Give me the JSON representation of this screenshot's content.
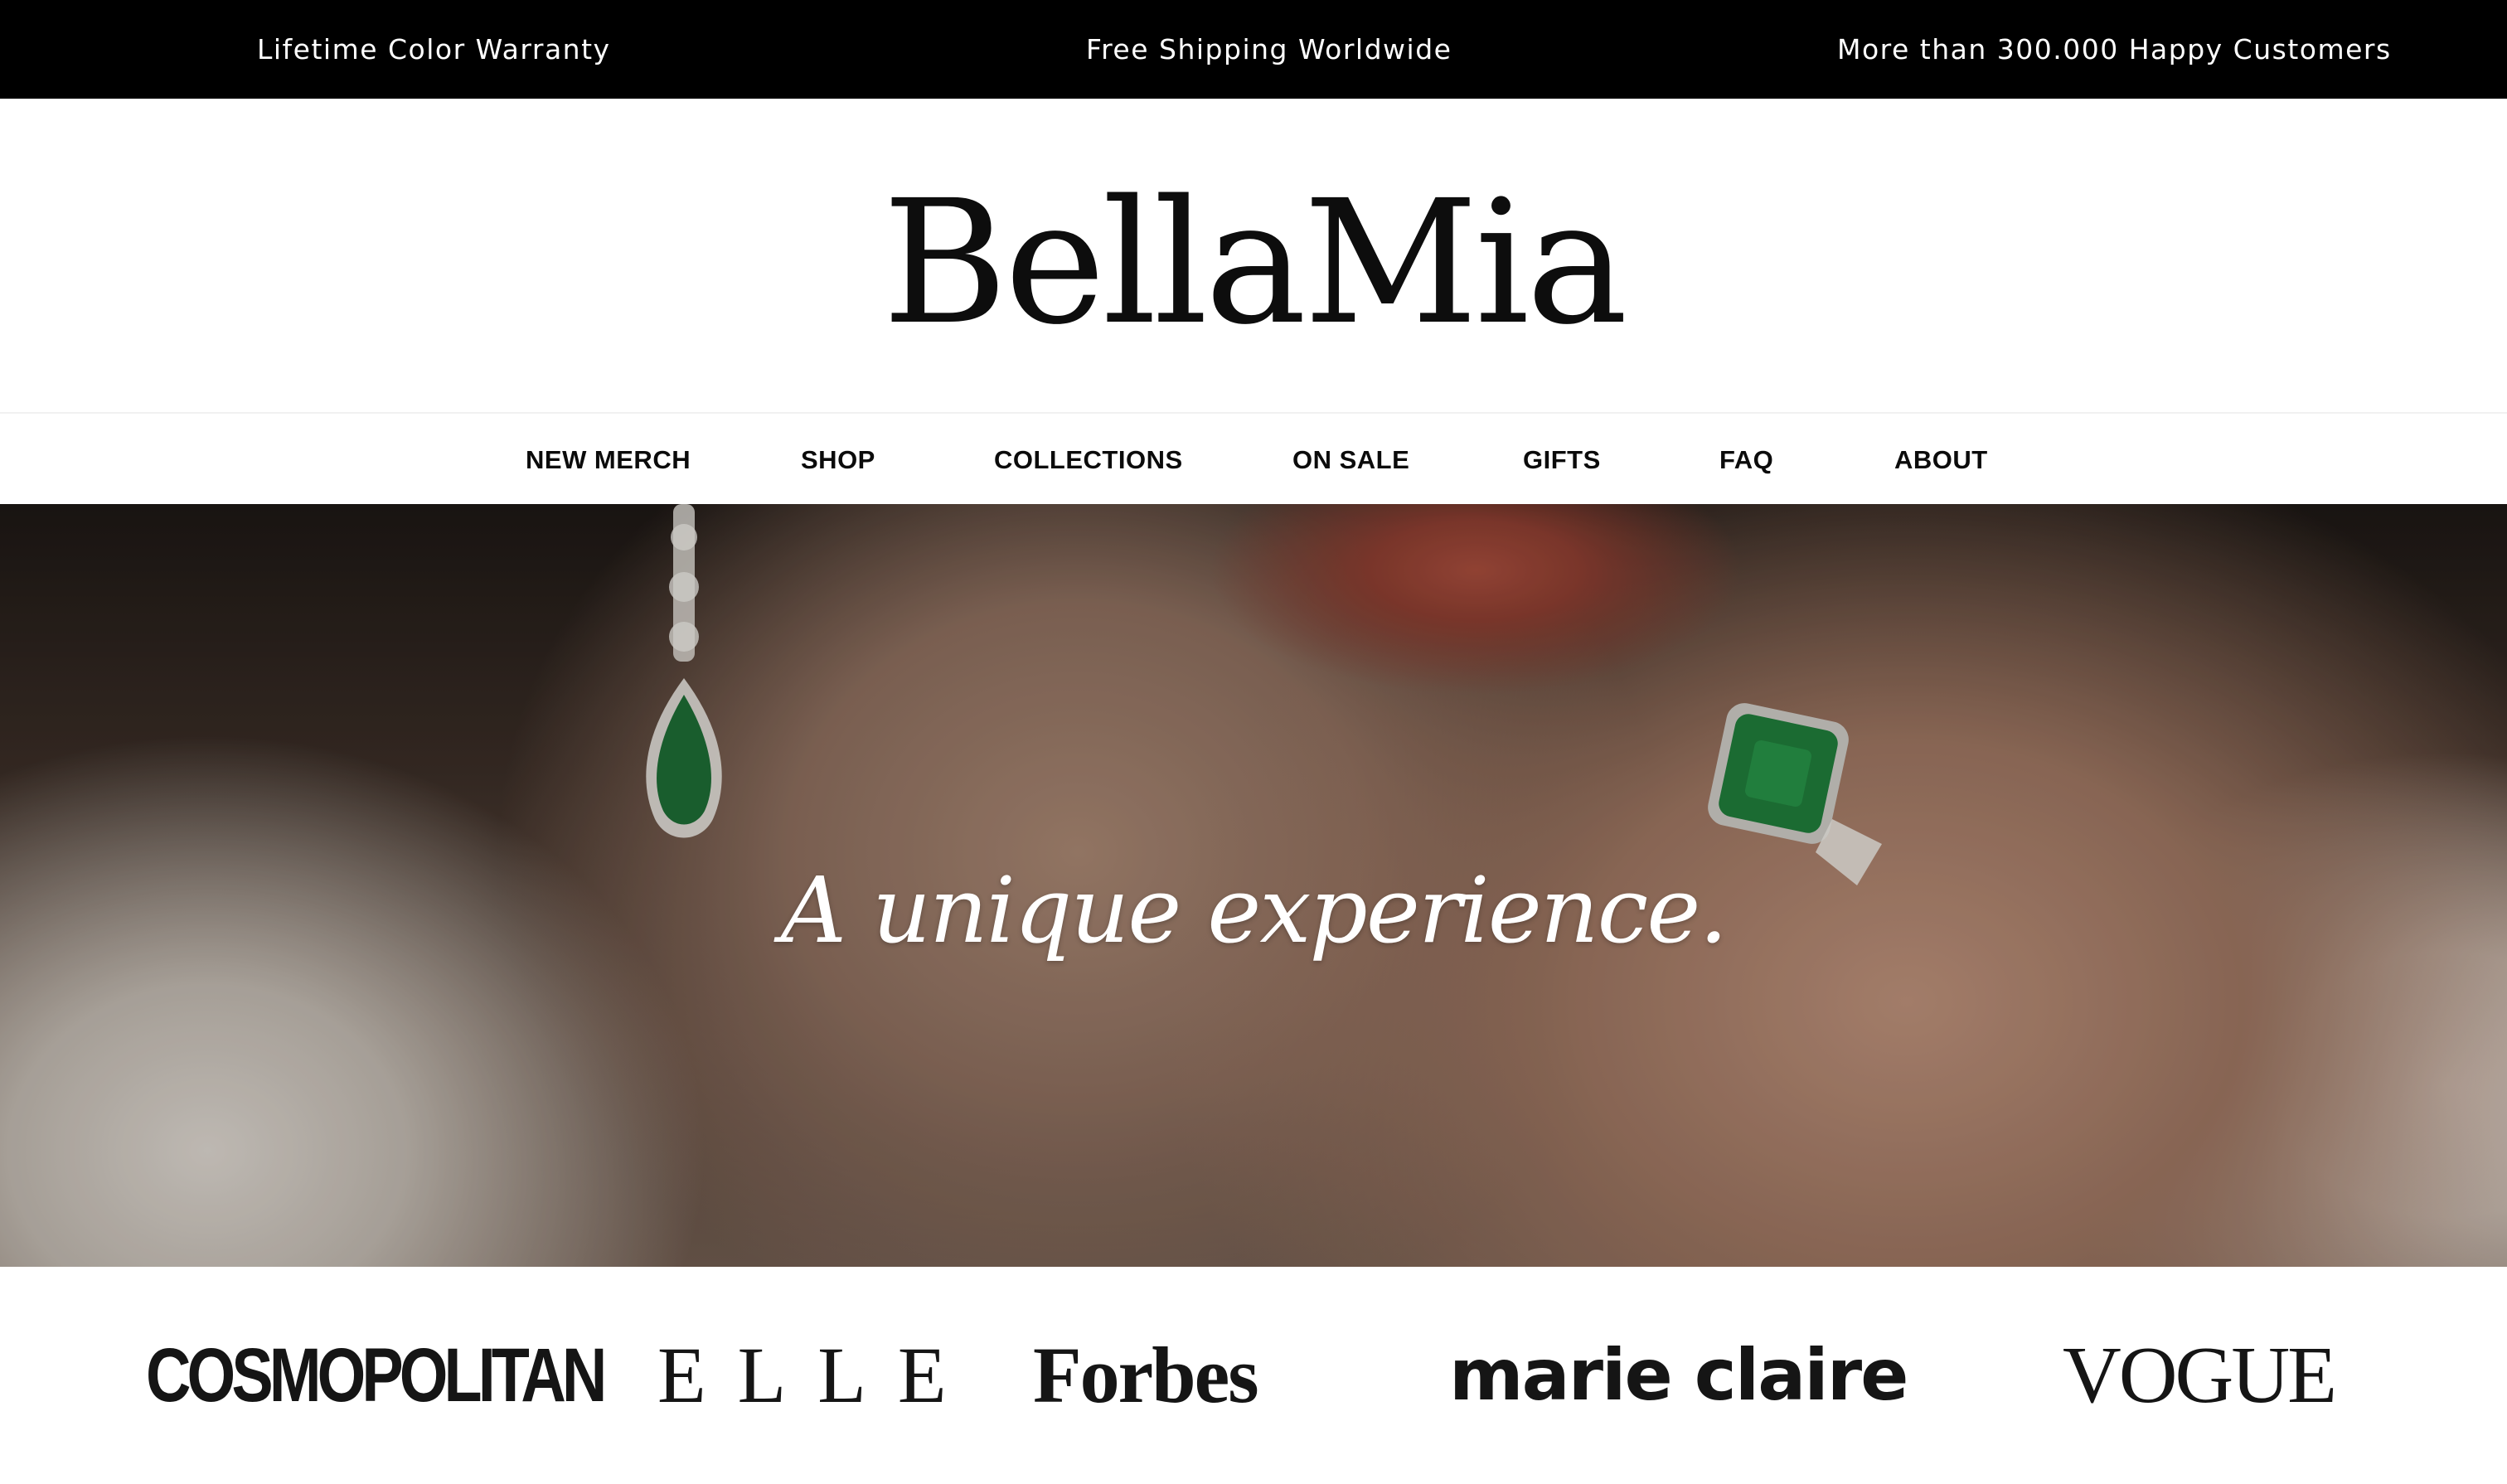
{
  "announcement_bar": {
    "messages": [
      "Lifetime Color Warranty",
      "Free Shipping Worldwide",
      "More than 300.000 Happy Customers"
    ]
  },
  "brand": {
    "logo_text": "BellaMia"
  },
  "nav": {
    "items": [
      {
        "label": "NEW MERCH"
      },
      {
        "label": "SHOP"
      },
      {
        "label": "COLLECTIONS"
      },
      {
        "label": "ON SALE"
      },
      {
        "label": "GIFTS"
      },
      {
        "label": "FAQ"
      },
      {
        "label": "ABOUT"
      }
    ]
  },
  "hero": {
    "tagline": "A unique experience."
  },
  "press": {
    "logos": [
      "COSMOPOLITAN",
      "ELLE",
      "Forbes",
      "marie claire",
      "VOGUE"
    ]
  },
  "colors": {
    "topbar_bg": "#000000",
    "topbar_text": "#ffffff",
    "text": "#111111",
    "gem_green": "#1f7a3a"
  }
}
